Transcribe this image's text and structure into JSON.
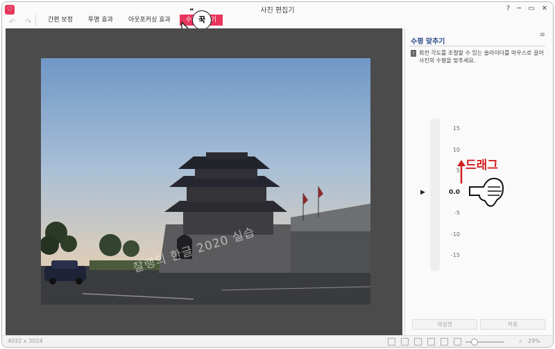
{
  "window": {
    "title": "사진 편집기",
    "help": "?",
    "minimize": "─",
    "restore": "▭",
    "close": "✕",
    "logo": "♡"
  },
  "toolbar": {
    "undo": "↶",
    "redo": "↷",
    "tabs": [
      {
        "label": "간편 보정",
        "active": false
      },
      {
        "label": "투명 효과",
        "active": false
      },
      {
        "label": "아웃포커싱 효과",
        "active": false
      },
      {
        "label": "수평 맞추기",
        "active": true
      }
    ],
    "callout": "꾹"
  },
  "photo": {
    "watermark": "찰랭의 한글 2020 실습"
  },
  "panel": {
    "title": "수평 맞추기",
    "menu": "≡",
    "info": "회전 각도를 조절할 수 있는 슬라이더를 마우스로 끌어 사진의 수평을 맞추세요.",
    "ticks": [
      "15",
      "10",
      "5",
      "0.0",
      "-5",
      "-10",
      "-15"
    ],
    "current_value": 0.0,
    "drag_annotation": "드래그",
    "reset_label": "재설정",
    "apply_label": "적용"
  },
  "status": {
    "image_size": "4032 x 3024",
    "zoom": "29%",
    "zoom_level": 0.15
  },
  "colors": {
    "accent": "#e8355c",
    "annotation": "#d1201f",
    "panel_title": "#2c4a8a"
  }
}
